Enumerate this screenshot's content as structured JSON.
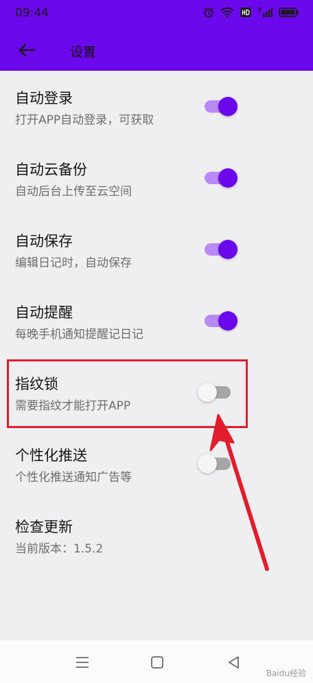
{
  "status_bar": {
    "time": "09:44"
  },
  "header": {
    "title": "设置",
    "back_icon": "arrow-left-icon"
  },
  "colors": {
    "accent": "#6c08ec",
    "switch_track_on": "#b98af5",
    "highlight": "#e21c2c"
  },
  "settings": [
    {
      "label": "自动登录",
      "sub": "打开APP自动登录，可获取",
      "enabled": true
    },
    {
      "label": "自动云备份",
      "sub": "自动后台上传至云空间",
      "enabled": true
    },
    {
      "label": "自动保存",
      "sub": "编辑日记时，自动保存",
      "enabled": true
    },
    {
      "label": "自动提醒",
      "sub": "每晚手机通知提醒记日记",
      "enabled": true
    },
    {
      "label": "指纹锁",
      "sub": "需要指纹才能打开APP",
      "enabled": false
    },
    {
      "label": "个性化推送",
      "sub": "个性化推送通知广告等",
      "enabled": false
    },
    {
      "label": "检查更新",
      "sub": "当前版本：1.5.2"
    }
  ],
  "nav": {
    "items": [
      "menu-icon",
      "home-square-icon",
      "back-triangle-icon"
    ]
  },
  "watermark": "Baidu经验"
}
